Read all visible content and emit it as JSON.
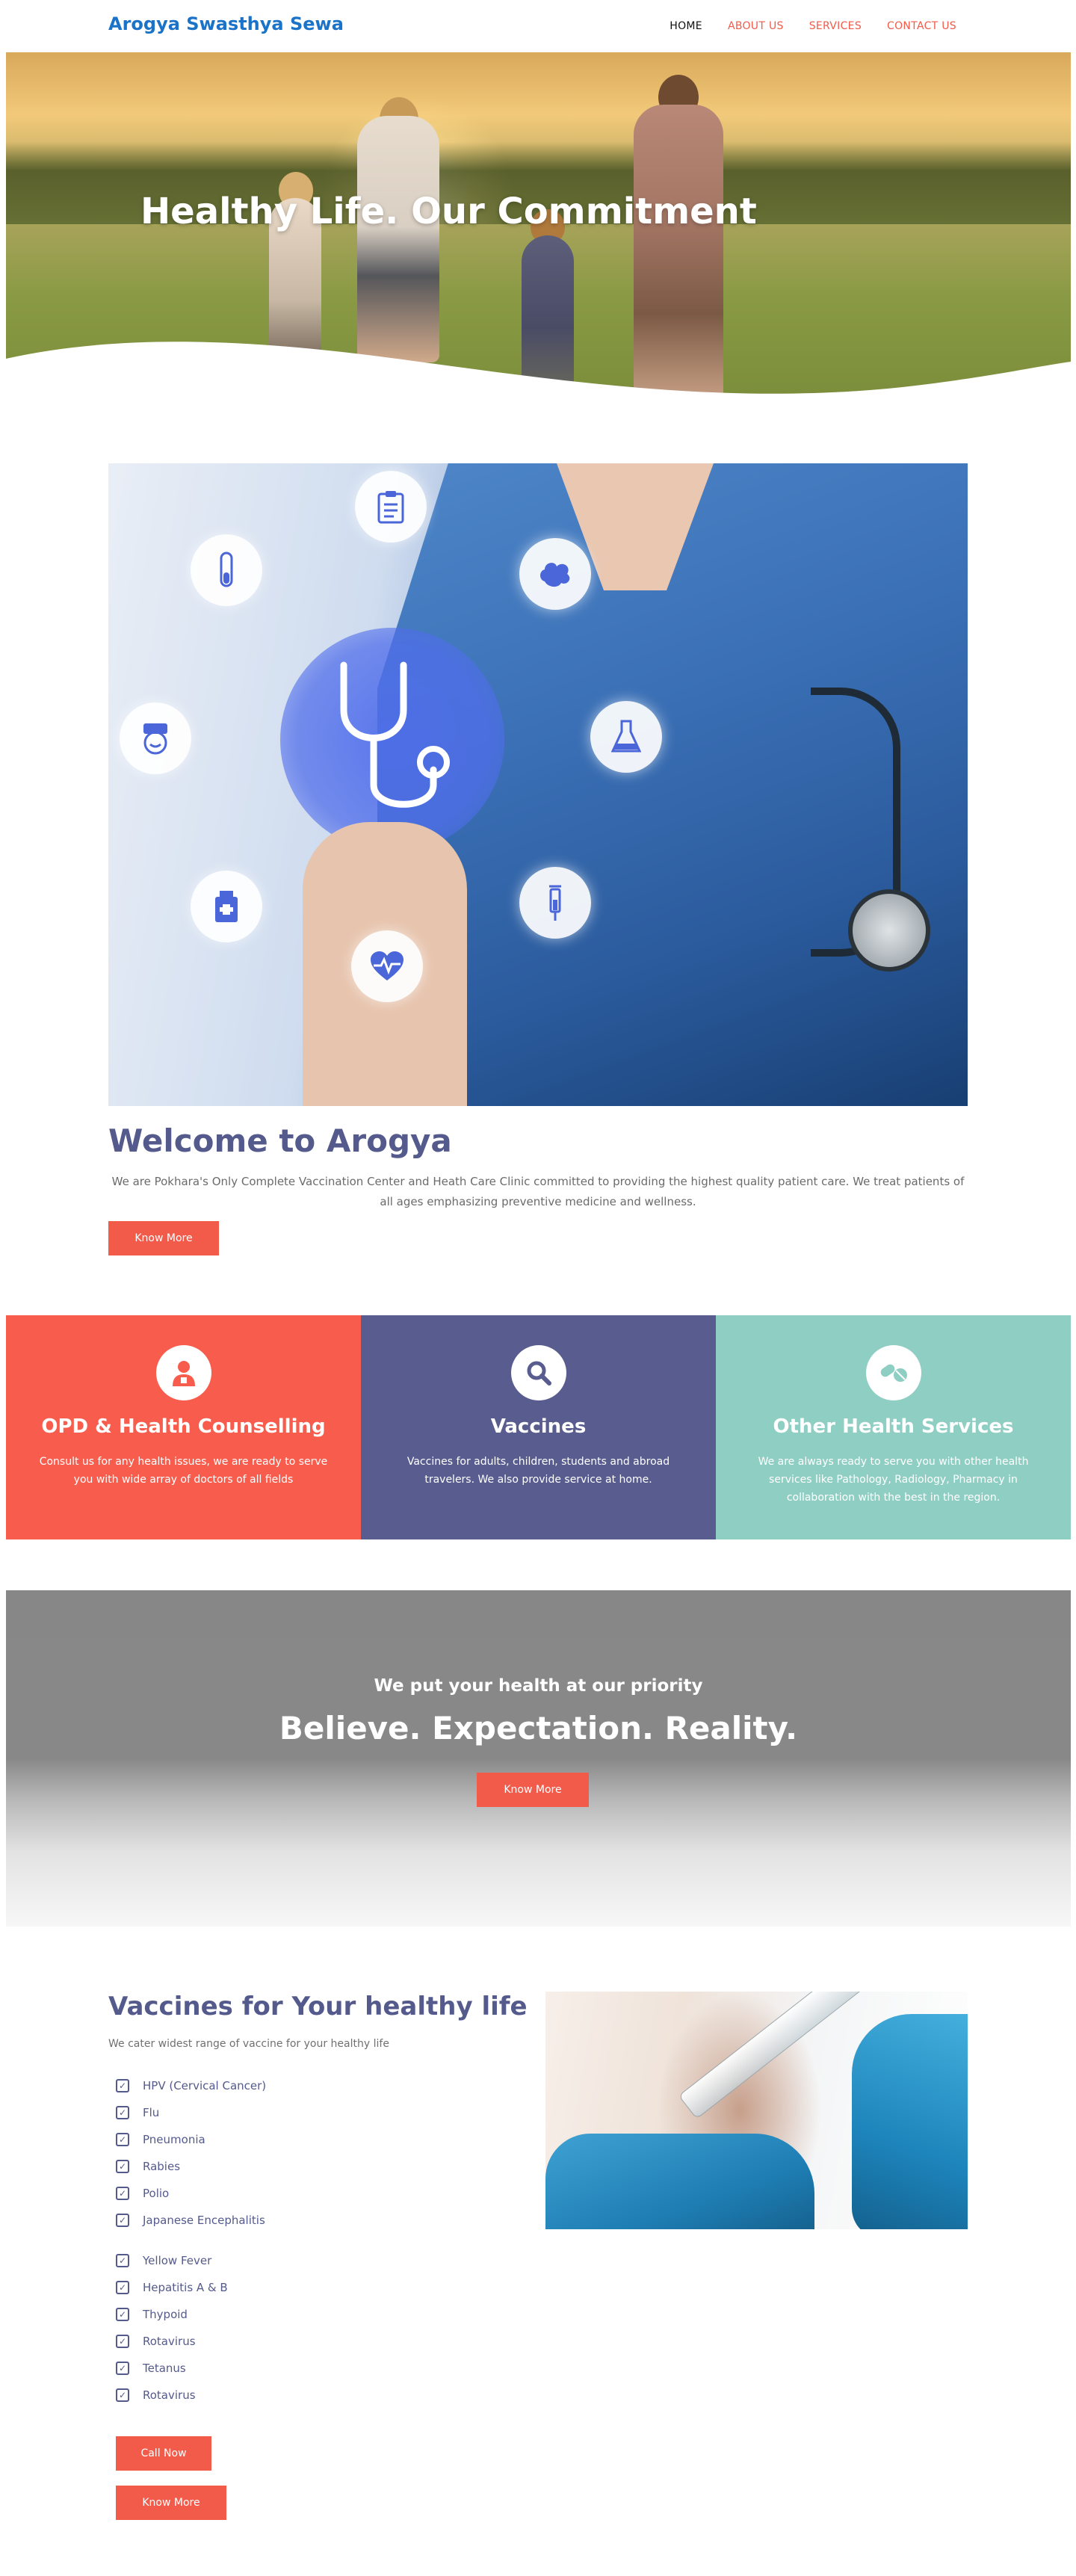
{
  "header": {
    "brand": "Arogya Swasthya Sewa",
    "nav": [
      "HOME",
      "ABOUT US",
      "SERVICES",
      "CONTACT US"
    ]
  },
  "hero": {
    "title": "Healthy Life. Our Commitment"
  },
  "welcome": {
    "title": "Welcome to Arogya",
    "text": "We are Pokhara's Only Complete Vaccination Center and Heath Care Clinic committed to providing the highest quality patient care. We treat patients of all ages emphasizing preventive medicine and wellness.",
    "button": "Know More",
    "image_icons": [
      "clipboard-icon",
      "test-tube-icon",
      "brain-icon",
      "nurse-icon",
      "flask-icon",
      "stethoscope-icon",
      "medicine-bottle-icon",
      "syringe-icon",
      "heart-pulse-icon"
    ]
  },
  "services": [
    {
      "icon": "doctor-icon",
      "title": "OPD & Health Counselling",
      "text": "Consult us for any health issues, we are ready to serve you with wide array of doctors of all fields",
      "color": "#f85c4c"
    },
    {
      "icon": "search-icon",
      "title": "Vaccines",
      "text": "Vaccines for adults, children, students and abroad travelers. We also provide service at home.",
      "color": "#585c8e"
    },
    {
      "icon": "pills-icon",
      "title": "Other Health Services",
      "text": "We are always ready to serve you with other health services like Pathology, Radiology, Pharmacy in collaboration with the best in the region.",
      "color": "#8ecec3"
    }
  ],
  "priority": {
    "kicker": "We put your health at our priority",
    "headline": "Believe. Expectation. Reality.",
    "button": "Know More"
  },
  "vaccines": {
    "title": "Vaccines for Your healthy life",
    "subtitle": "We cater widest range of vaccine for your healthy life",
    "list1": [
      "HPV (Cervical Cancer)",
      "Flu",
      "Pneumonia",
      "Rabies",
      "Polio",
      "Japanese Encephalitis"
    ],
    "list2": [
      "Yellow Fever",
      "Hepatitis A & B",
      "Thypoid",
      "Rotavirus",
      "Tetanus",
      "Rotavirus"
    ],
    "call_button": "Call Now",
    "more_button": "Know More"
  },
  "colors": {
    "brand": "#1a73c8",
    "accent": "#f25a4a",
    "indigo": "#545a8c",
    "teal": "#8ecec3"
  }
}
